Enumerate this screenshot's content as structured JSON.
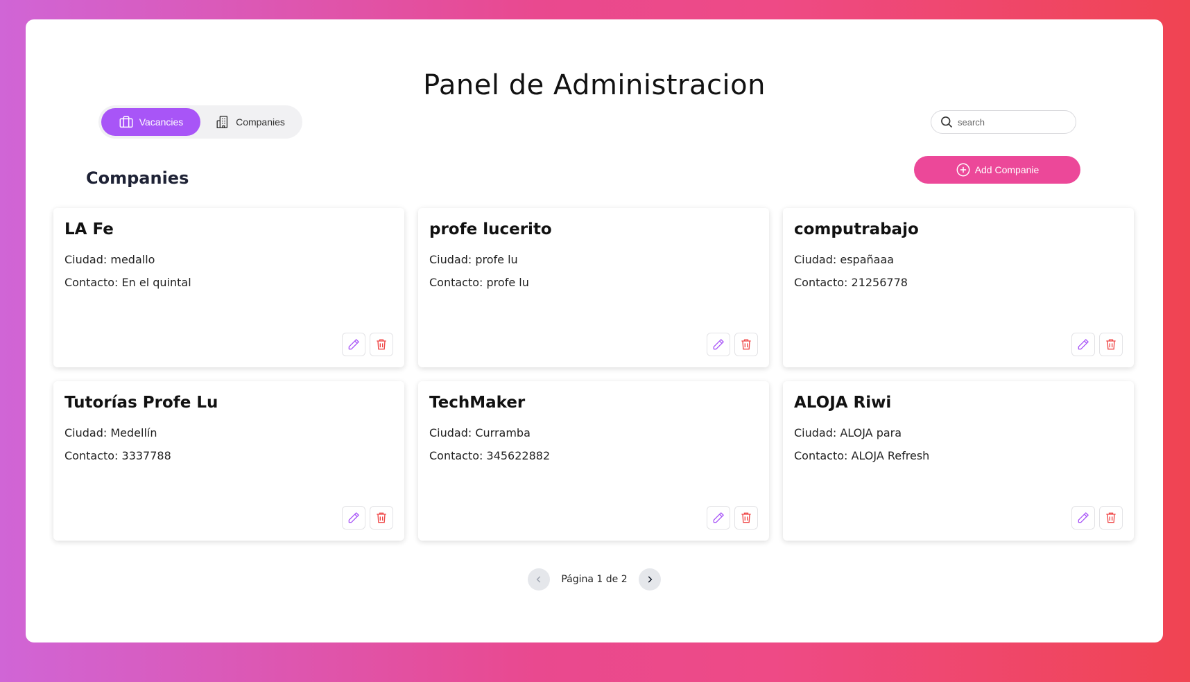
{
  "header": {
    "title": "Panel de Administracion"
  },
  "tabs": [
    {
      "label": "Vacancies",
      "icon": "briefcase-icon",
      "active": true
    },
    {
      "label": "Companies",
      "icon": "building-icon",
      "active": false
    }
  ],
  "search": {
    "placeholder": "search",
    "value": ""
  },
  "section": {
    "title": "Companies",
    "add_label": "Add Companie"
  },
  "labels": {
    "city": "Ciudad: ",
    "contact": "Contacto: "
  },
  "companies": [
    {
      "name": "LA Fe",
      "city_line": "Ciudad: medallo",
      "contact_line": "Contacto: En el quintal"
    },
    {
      "name": "profe lucerito",
      "city_line": "Ciudad: profe lu",
      "contact_line": "Contacto: profe lu"
    },
    {
      "name": "computrabajo",
      "city_line": "Ciudad: españaaa",
      "contact_line": "Contacto: 21256778"
    },
    {
      "name": "Tutorías Profe Lu",
      "city_line": "Ciudad: Medellín",
      "contact_line": "Contacto: 3337788"
    },
    {
      "name": "TechMaker",
      "city_line": "Ciudad: Curramba",
      "contact_line": "Contacto: 345622882"
    },
    {
      "name": "ALOJA Riwi",
      "city_line": "Ciudad: ALOJA para",
      "contact_line": "Contacto: ALOJA Refresh"
    }
  ],
  "pagination": {
    "label": "Página 1 de 2",
    "current": 1,
    "total": 2
  },
  "colors": {
    "accent_purple": "#a855f7",
    "accent_pink": "#ec4899",
    "delete_red": "#ef4444"
  }
}
